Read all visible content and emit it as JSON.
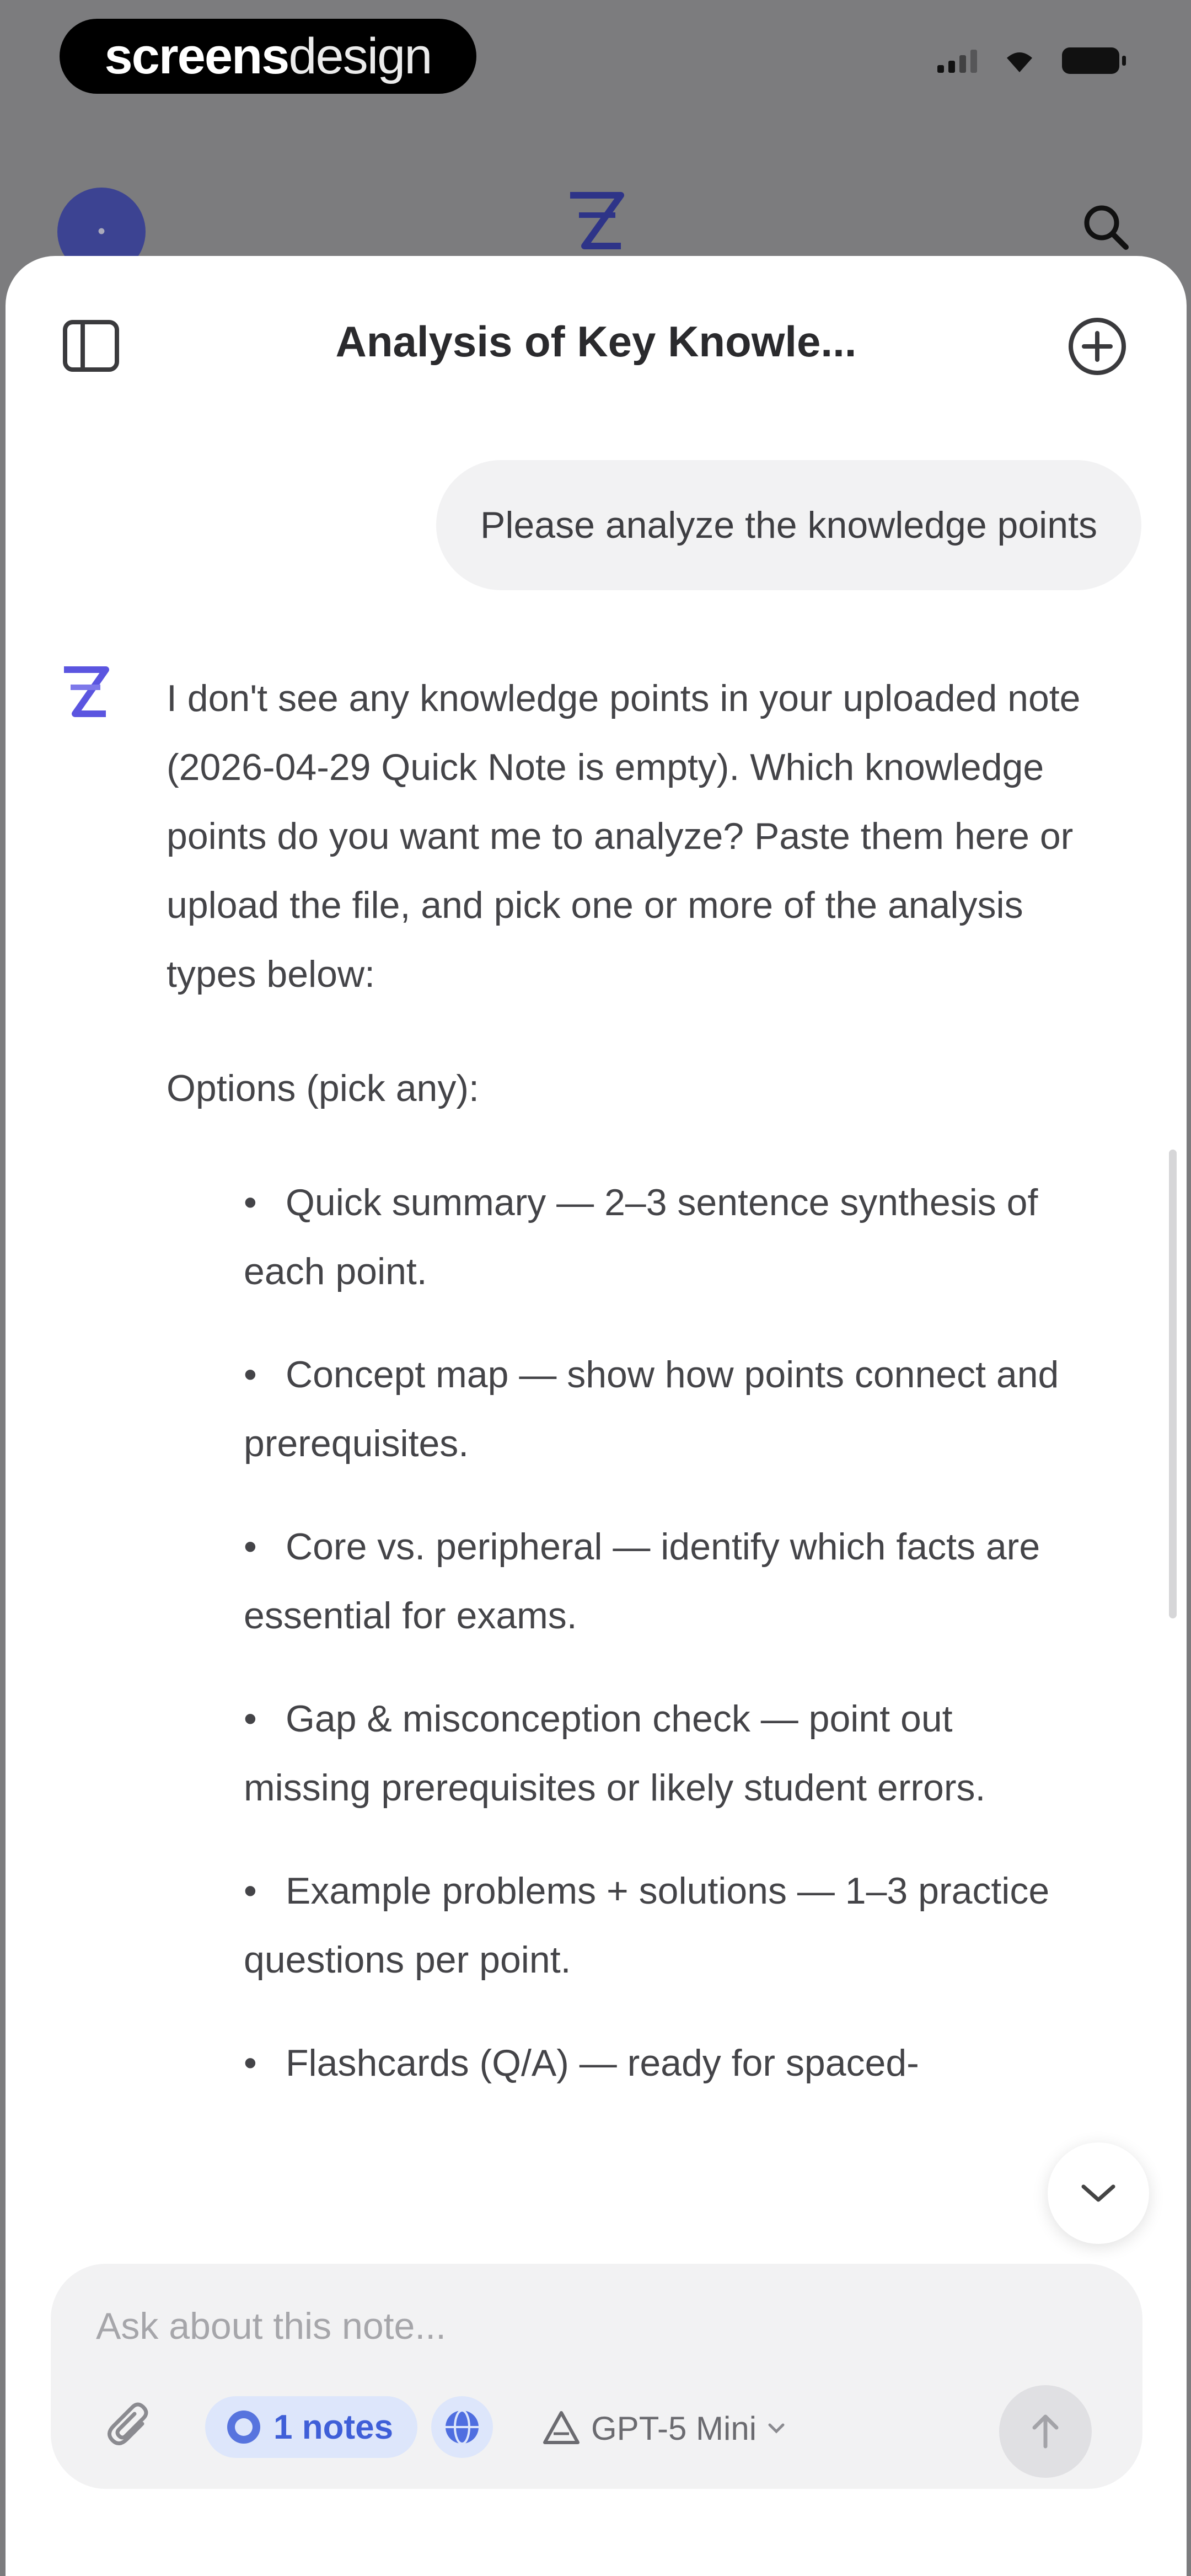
{
  "status_bar": {
    "watermark_bold": "screens",
    "watermark_light": "design"
  },
  "header": {
    "title": "Analysis of Key Knowle...",
    "sidebar_icon": "sidebar-icon",
    "new_chat_icon": "plus-circle-icon"
  },
  "messages": {
    "user": "Please analyze the knowledge points",
    "assistant_intro": "I don't see any knowledge points in your uploaded note (2026-04-29 Quick Note is empty). Which knowledge points do you want me to analyze? Paste them here or upload the file, and pick one or more of the analysis types below:",
    "options_heading": "Options (pick any):",
    "bullet": "•",
    "options": [
      "Quick summary — 2–3 sentence synthesis of each point.",
      "Concept map — show how points connect and prerequisites.",
      "Core vs. peripheral — identify which facts are essential for exams.",
      "Gap & misconception check — point out missing prerequisites or likely student errors.",
      "Example problems + solutions — 1–3 practice questions per point.",
      "Flashcards (Q/A) — ready for spaced-"
    ]
  },
  "composer": {
    "placeholder": "Ask about this note...",
    "notes_chip": "1 notes",
    "model": "GPT-5 Mini"
  },
  "colors": {
    "accent": "#3f5fd8",
    "chip_bg": "#dde6fb",
    "brand_indigo": "#3c4392",
    "dim_backdrop": "#7c7c7e"
  }
}
